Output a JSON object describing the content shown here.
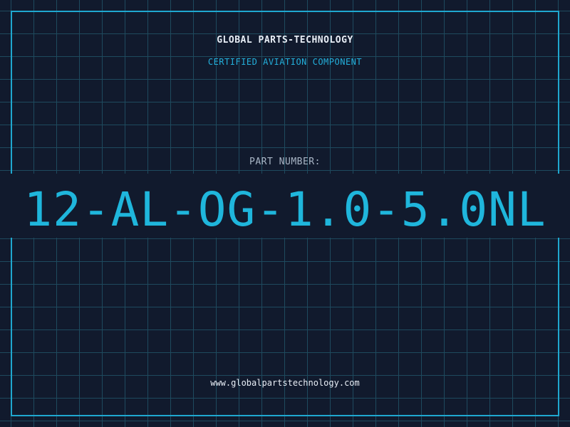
{
  "header": {
    "company_name": "GLOBAL PARTS-TECHNOLOGY",
    "tagline": "CERTIFIED AVIATION COMPONENT"
  },
  "part": {
    "label": "PART NUMBER:",
    "number": "12-AL-OG-1.0-5.0NL"
  },
  "footer": {
    "website": "www.globalpartstechnology.com"
  },
  "colors": {
    "background": "#111a2d",
    "grid": "#1e4a5e",
    "accent": "#1fb6dc",
    "text": "#e8eef6"
  }
}
